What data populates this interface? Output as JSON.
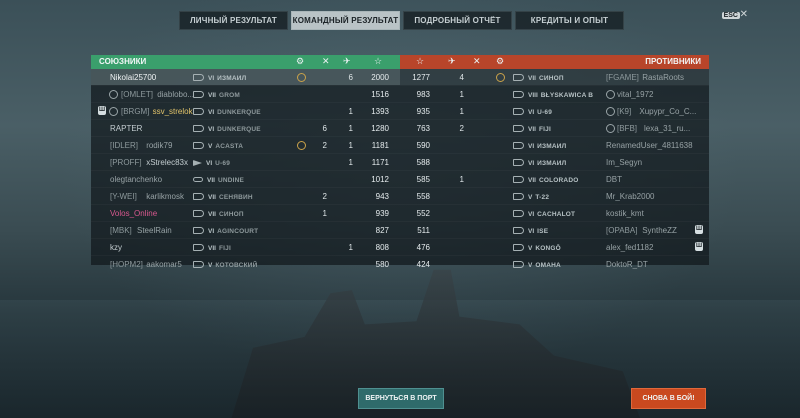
{
  "tabs": [
    {
      "label": "ЛИЧНЫЙ РЕЗУЛЬТАТ",
      "active": false
    },
    {
      "label": "КОМАНДНЫЙ РЕЗУЛЬТАТ",
      "active": true
    },
    {
      "label": "ПОДРОБНЫЙ ОТЧЁТ",
      "active": false
    },
    {
      "label": "КРЕДИТЫ И ОПЫТ",
      "active": false
    }
  ],
  "esc_label": "ESC",
  "close_glyph": "✕",
  "allies": {
    "title": "СОЮЗНИКИ",
    "header_icons": [
      "medal-icon",
      "swords-icon",
      "plane-icon",
      "star-icon"
    ],
    "rows": [
      {
        "clan": "",
        "name": "Nikolai25700",
        "tier": "VI",
        "ship": "ИЗМАИЛ",
        "kills": "6",
        "xp": "2000",
        "me": true
      },
      {
        "clan": "[OMLET]",
        "name": "diablobo...",
        "tier": "VII",
        "ship": "GROM",
        "kills": "",
        "xp": "1516"
      },
      {
        "clan": "[BRGM]",
        "name": "ssv_strelok",
        "tier": "VI",
        "ship": "DUNKERQUE",
        "kills": "1",
        "xp": "1393"
      },
      {
        "clan": "",
        "name": "RAPTER",
        "tier": "VI",
        "ship": "DUNKERQUE",
        "kills": "1",
        "xp": "1280"
      },
      {
        "clan": "[IDLER]",
        "name": "rodik79",
        "tier": "V",
        "ship": "ACASTA",
        "kills": "1",
        "xp": "1181"
      },
      {
        "clan": "[PROFF]",
        "name": "xStrelec83x",
        "tier": "VI",
        "ship": "U-69",
        "kills": "1",
        "xp": "1171"
      },
      {
        "clan": "",
        "name": "olegtanchenko",
        "tier": "VII",
        "ship": "UNDINE",
        "kills": "",
        "xp": "1012"
      },
      {
        "clan": "[Y-WEI]",
        "name": "karlikmosk",
        "tier": "VII",
        "ship": "СЕНЯВИН",
        "kills": "",
        "xp": "943"
      },
      {
        "clan": "",
        "name": "Volos_Online",
        "tier": "VII",
        "ship": "СИНОП",
        "kills": "",
        "xp": "939"
      },
      {
        "clan": "[MBK]",
        "name": "SteelRain",
        "tier": "VI",
        "ship": "AGINCOURT",
        "kills": "",
        "xp": "827"
      },
      {
        "clan": "",
        "name": "kzy",
        "tier": "VII",
        "ship": "FIJI",
        "kills": "1",
        "xp": "808"
      },
      {
        "clan": "[HOPM2]",
        "name": "aakomar5",
        "tier": "V",
        "ship": "КОТОВСКИЙ",
        "kills": "",
        "xp": "580"
      }
    ],
    "extra": {
      "r0_medal": "1",
      "r3_planes": "6",
      "r4_medal": "",
      "r4_swords": "2",
      "r7_swords": "2",
      "r8_swords": "1"
    }
  },
  "enemies": {
    "title": "ПРОТИВНИКИ",
    "header_icons": [
      "star-icon",
      "plane-icon",
      "swords-icon",
      "medal-icon"
    ],
    "rows": [
      {
        "xp": "1277",
        "planes": "4",
        "tier": "VII",
        "ship": "СИНОП",
        "clan": "[FGAME]",
        "name": "RastaRoots"
      },
      {
        "xp": "983",
        "planes": "1",
        "tier": "VIII",
        "ship": "BŁYSKAWICA B",
        "clan": "",
        "name": "vital_1972"
      },
      {
        "xp": "935",
        "planes": "1",
        "tier": "VI",
        "ship": "U-69",
        "clan": "[K9]",
        "name": "Xupypr_Co_C..."
      },
      {
        "xp": "763",
        "planes": "2",
        "tier": "VII",
        "ship": "FIJI",
        "clan": "[BFB]",
        "name": "lexa_31_ru..."
      },
      {
        "xp": "590",
        "planes": "",
        "tier": "VI",
        "ship": "ИЗМАИЛ",
        "clan": "",
        "name": "RenamedUser_4811638"
      },
      {
        "xp": "588",
        "planes": "",
        "tier": "VI",
        "ship": "ИЗМАИЛ",
        "clan": "",
        "name": "Im_Segyn"
      },
      {
        "xp": "585",
        "planes": "1",
        "tier": "VII",
        "ship": "COLORADO",
        "clan": "",
        "name": "DBT"
      },
      {
        "xp": "558",
        "planes": "",
        "tier": "V",
        "ship": "T-22",
        "clan": "",
        "name": "Mr_Krab2000"
      },
      {
        "xp": "552",
        "planes": "",
        "tier": "VI",
        "ship": "CACHALOT",
        "clan": "",
        "name": "kostik_kmt"
      },
      {
        "xp": "511",
        "planes": "",
        "tier": "VI",
        "ship": "ISE",
        "clan": "[OPABA]",
        "name": "SyntheZZ"
      },
      {
        "xp": "476",
        "planes": "",
        "tier": "V",
        "ship": "KONGŌ",
        "clan": "",
        "name": "alex_fed1182"
      },
      {
        "xp": "424",
        "planes": "",
        "tier": "V",
        "ship": "OMAHA",
        "clan": "",
        "name": "DoktoR_DT"
      }
    ]
  },
  "buttons": {
    "port": "ВЕРНУТЬСЯ В ПОРТ",
    "battle": "СНОВА В БОЙ!"
  },
  "colors": {
    "allies": "#3a9f6c",
    "enemies": "#b8452a",
    "port_button": "#2f6b6b",
    "battle_button": "#c9491f"
  }
}
